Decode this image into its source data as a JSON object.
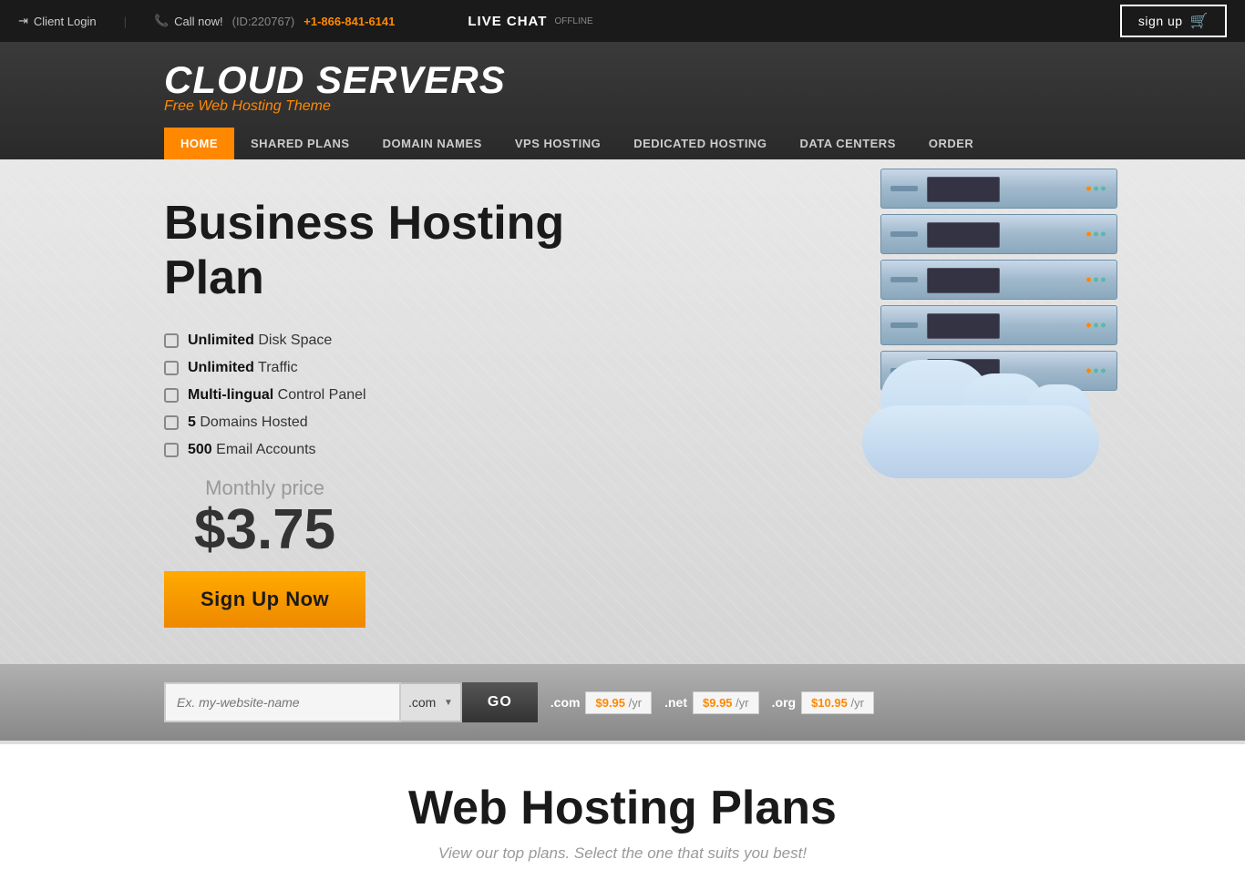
{
  "topbar": {
    "client_login": "Client Login",
    "call_label": "Call now!",
    "call_id": "(ID:220767)",
    "phone": "+1-866-841-6141",
    "live_chat": "LIVE CHAT",
    "offline": "OFFLINE",
    "signup": "sign up"
  },
  "header": {
    "brand": "CLOUD SERVERS",
    "tagline": "Free Web Hosting Theme"
  },
  "nav": {
    "items": [
      {
        "label": "HOME",
        "active": true
      },
      {
        "label": "SHARED PLANS",
        "active": false
      },
      {
        "label": "DOMAIN NAMES",
        "active": false
      },
      {
        "label": "VPS HOSTING",
        "active": false
      },
      {
        "label": "DEDICATED HOSTING",
        "active": false
      },
      {
        "label": "DATA CENTERS",
        "active": false
      },
      {
        "label": "ORDER",
        "active": false
      }
    ]
  },
  "hero": {
    "title": "Business Hosting Plan",
    "features": [
      {
        "bold": "Unlimited",
        "text": " Disk Space"
      },
      {
        "bold": "Unlimited",
        "text": " Traffic"
      },
      {
        "bold": "Multi-lingual",
        "text": " Control Panel"
      },
      {
        "bold": "5",
        "text": " Domains Hosted"
      },
      {
        "bold": "500",
        "text": " Email Accounts"
      }
    ],
    "pricing": {
      "label": "Monthly price",
      "price": "$3.75"
    },
    "cta": "Sign Up Now"
  },
  "domain": {
    "placeholder": "Ex. my-website-name",
    "tld_default": ".com",
    "go_label": "GO",
    "tlds": [
      {
        "name": ".com",
        "price": "$9.95",
        "unit": "/yr"
      },
      {
        "name": ".net",
        "price": "$9.95",
        "unit": "/yr"
      },
      {
        "name": ".org",
        "price": "$10.95",
        "unit": "/yr"
      }
    ]
  },
  "plans_section": {
    "title": "Web Hosting Plans",
    "subtitle": "View our top plans. Select the one that suits you best!"
  }
}
